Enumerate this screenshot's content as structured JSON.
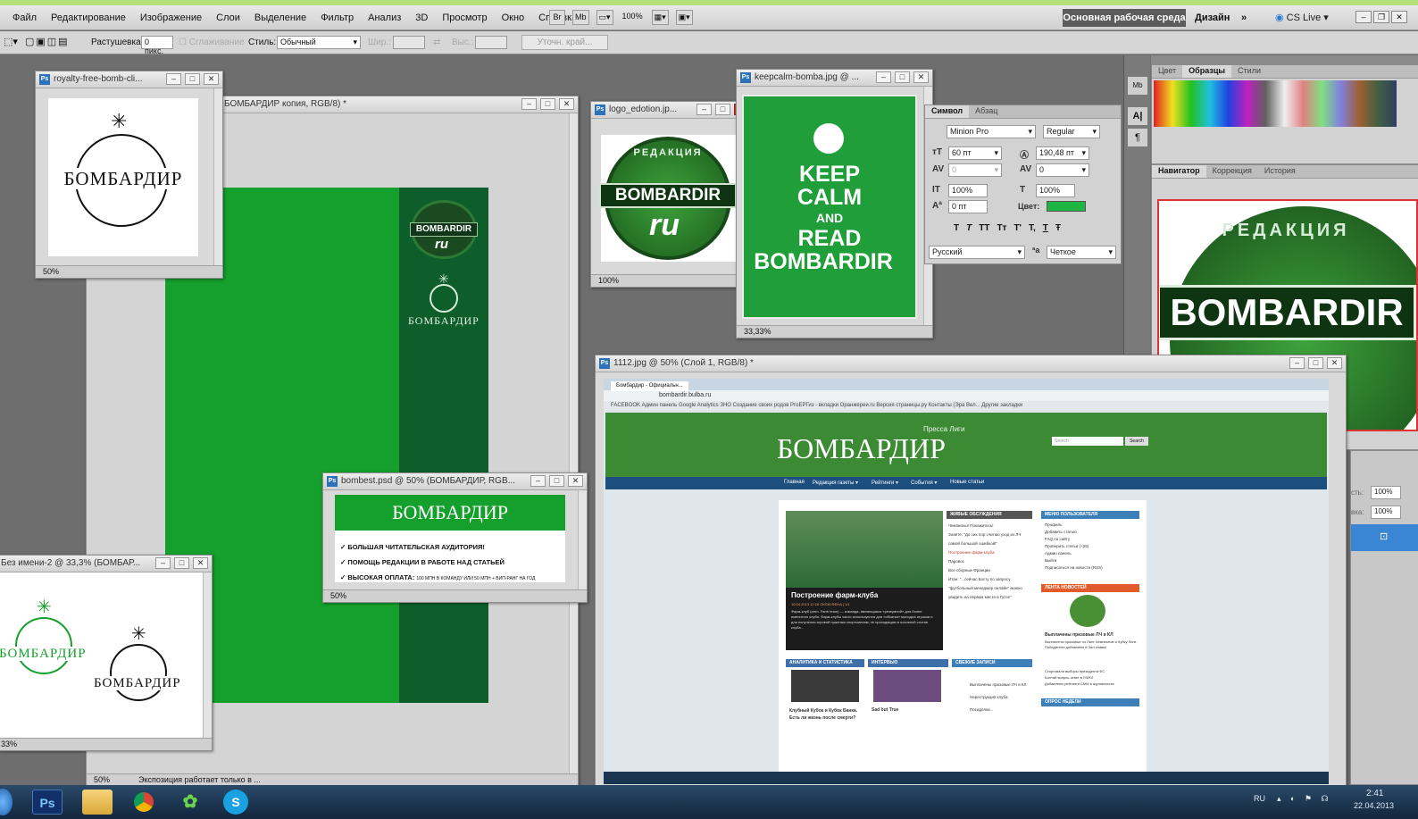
{
  "menu": [
    "Файл",
    "Редактирование",
    "Изображение",
    "Слои",
    "Выделение",
    "Фильтр",
    "Анализ",
    "3D",
    "Просмотр",
    "Окно",
    "Справка"
  ],
  "menubar": {
    "zoom": "100%",
    "mini_bridge": "Mb",
    "workspace_main": "Основная рабочая среда",
    "workspace_design": "Дизайн",
    "more": "»",
    "cslive": "CS Live"
  },
  "options": {
    "feather_label": "Растушевка:",
    "feather_value": "0 пикс.",
    "antialias_label": "Сглаживание",
    "style_label": "Стиль:",
    "style_value": "Обычный",
    "width_label": "Шир.:",
    "height_label": "Выс.:",
    "refine_edge": "Уточн. край..."
  },
  "windows": {
    "main_doc": {
      "title": "БОМБАРДИР копия, RGB/8) *",
      "zoom": "50%",
      "status": "Экспозиция работает только в ..."
    },
    "royalty": {
      "title": "royalty-free-bomb-cli...",
      "zoom": "50%",
      "logo_text": "БОМБАРДИР"
    },
    "logo_edition": {
      "title": "logo_edotion.jp...",
      "zoom": "100%",
      "badge_top": "РЕДАКЦИЯ",
      "badge_main": "BOMBARDIR",
      "badge_sub": "ru"
    },
    "keepcalm": {
      "title": "keepcalm-bomba.jpg @ ...",
      "zoom": "33,33%",
      "line1": "KEEP",
      "line2": "CALM",
      "line3": "AND",
      "line4": "READ",
      "line5": "BOMBARDIR"
    },
    "bombest": {
      "title": "bombest.psd @ 50% (БОМБАРДИР, RGB...",
      "zoom": "50%",
      "header": "БОМБАРДИР",
      "bullets": [
        "✓ БОЛЬШАЯ ЧИТАТЕЛЬСКАЯ АУДИТОРИЯ!",
        "✓ ПОМОЩЬ РЕДАКЦИИ В РАБОТЕ НАД СТАТЬЕЙ",
        "✓ ВЫСОКАЯ ОПЛАТА:"
      ],
      "bullet3_small": "100 МПН В КОМАНДУ ИЛИ 50 МПН + ВИП-РАНГ НА ГОД"
    },
    "untitled": {
      "title": "Без имени-2 @ 33,3% (БОМБАР...",
      "zoom": "33%",
      "logo_left": "БОМБАРДИР",
      "logo_right": "БОМБАРДИР"
    },
    "site_shot": {
      "title": "1112.jpg @ 50% (Слой 1, RGB/8) *"
    },
    "main_canvas": {
      "badge_main": "BOMBARDIR",
      "badge_sub": "ru",
      "logo_text": "БОМБАРДИР"
    }
  },
  "character_panel": {
    "tabs": [
      "Символ",
      "Абзац"
    ],
    "font": "Minion Pro",
    "style": "Regular",
    "size": "60 пт",
    "leading": "190,48 пт",
    "kerning": "0",
    "tracking": "0",
    "vscale": "100%",
    "hscale": "100%",
    "baseline": "0 пт",
    "color_label": "Цвет:",
    "language": "Русский",
    "aa_label": "ªa",
    "antialias": "Четкое",
    "type_buttons": [
      "T",
      "T",
      "TT",
      "Tт",
      "T'",
      "T,",
      "T",
      "Ŧ"
    ],
    "color": "#1fb543"
  },
  "swatches_panel": {
    "tabs": [
      "Цвет",
      "Образцы",
      "Стили"
    ]
  },
  "navigator_panel": {
    "tabs": [
      "Навигатор",
      "Коррекция",
      "История"
    ],
    "badge_text": "BOMBARDIR",
    "badge_top": "РЕДАКЦИЯ"
  },
  "layers_panel": {
    "opacity_label": "сть:",
    "opacity": "100%",
    "fill_label": "вка:",
    "fill": "100%"
  },
  "website": {
    "url": "bombardir.bulba.ru",
    "browser_tab": "Бомбардир - Официальн...",
    "bookmarks": "FACEBOOK   Админ панель   Google Analytics   ЗНО   Создание своих родов   РгоЕРГиз - вкладки   Оранжереи.ru   Версия страницы.ру   Контакты (Эра Вел...   Другие закладки",
    "tagline": "Пресса Лиги",
    "logo": "БОМБАРДИР",
    "search_placeholder": "Search",
    "search_button": "Search",
    "nav": [
      "Главная",
      "Редакция газеты ▾",
      "Рейтинги ▾",
      "События ▾",
      "Новые статьи"
    ],
    "feature_title": "Построение фарм-клуба",
    "feature_meta": "10.04.2013 12:18   OKSKI/ФЕНА | 1/1",
    "feature_text": "Фарм-клуб (англ. Farm team) — команда, являющаяся «резервной» для более именитого клуба. Фарм-клубы часто используются для «обкатки» молодых игроков и для получения игровой практики спортсменам, не проходящим в основной состав клуба...",
    "latest_header": "ЖИВЫЕ ОБСУЖДЕНИЯ",
    "latest": [
      "Чемпионы! Покажитесь!",
      "Знаёте: \"До сих пор считаю уход из ЛЧ самой большой ошибкой!\"",
      "Построение фарм-клуба",
      "Паровоз",
      "Все сборные Франции",
      "Итан: \"...сейчас Бэсту по запросу \"футбольный менеджер онлайн\" можно увидеть на первом месте в Гугле\""
    ],
    "menu_header": "МЕНЮ ПОЛЬЗОВАТЕЛЯ",
    "user_menu": [
      "Профиль",
      "Добавить статью",
      "FAQ по сайту",
      "Проверить статьи (+25)",
      "Админ панель",
      "Выйти",
      "Подписаться на новости (RSS)"
    ],
    "news_header": "ЛЕНТА НОВОСТЕЙ",
    "news_title": "Выплачены призовые ЛЧ и КЛ",
    "news_text": "Выплачены призовые по Лиге Чемпионов и Кубку Лиги. Победители добавлены в Зал славы!",
    "cat1": "АНАЛИТИКА И СТАТИСТИКА",
    "cat1_title": "Клубный Кубок и Кубок Банка. Есть ли жизнь после смерти?",
    "cat2": "ИНТЕРВЬЮ",
    "cat2_title": "Sad but True",
    "cat3": "СВЕЖИЕ ЗАПИСИ",
    "cat3_items": [
      "Выплачены призовые ЛЧ и КЛ",
      "Нереструкция клуба",
      "Посиделки..."
    ],
    "poll_header": "ОПРОС НЕДЕЛИ",
    "poll_items": [
      "Стартовали выборы президента ФС",
      "Болтай вопрос-ответ в ЛЧ/КЛ",
      "Добавлены рейтинги СММ в журналистах"
    ]
  },
  "taskbar": {
    "apps": [
      "Ps",
      "S"
    ],
    "lang": "RU",
    "time": "2:41",
    "date": "22.04.2013"
  },
  "colors": {
    "bomb_green": "#159f2c",
    "dark_green": "#0d5e2a",
    "keepcalm_green": "#1f9e3a",
    "workspace_active": "#5c5c5c"
  }
}
